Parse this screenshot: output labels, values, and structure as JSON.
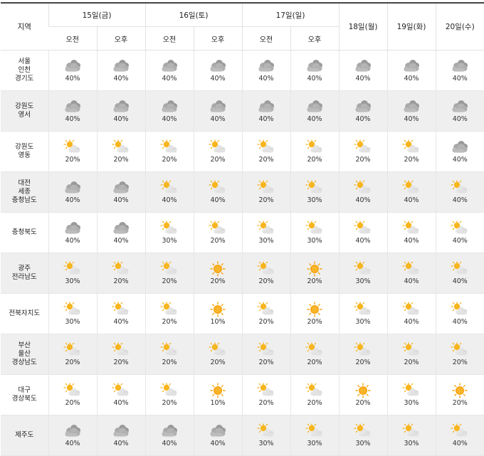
{
  "header": {
    "region": "지역",
    "days": [
      {
        "label": "15일(금)",
        "am": "오전",
        "pm": "오후"
      },
      {
        "label": "16일(토)",
        "am": "오전",
        "pm": "오후"
      },
      {
        "label": "17일(일)",
        "am": "오전",
        "pm": "오후"
      },
      {
        "label": "18일(월)"
      },
      {
        "label": "19일(화)"
      },
      {
        "label": "20일(수)"
      }
    ]
  },
  "icons": {
    "cloud": "cloudy-icon",
    "partly": "partly-cloudy-icon",
    "sun": "sunny-icon"
  },
  "rows": [
    {
      "region": "서울\n인천\n경기도",
      "cells": [
        [
          "cloud",
          "40%"
        ],
        [
          "cloud",
          "40%"
        ],
        [
          "cloud",
          "40%"
        ],
        [
          "cloud",
          "40%"
        ],
        [
          "cloud",
          "40%"
        ],
        [
          "cloud",
          "40%"
        ],
        [
          "cloud",
          "40%"
        ],
        [
          "cloud",
          "40%"
        ],
        [
          "cloud",
          "40%"
        ]
      ]
    },
    {
      "region": "강원도\n영서",
      "cells": [
        [
          "cloud",
          "40%"
        ],
        [
          "cloud",
          "40%"
        ],
        [
          "cloud",
          "40%"
        ],
        [
          "cloud",
          "40%"
        ],
        [
          "cloud",
          "40%"
        ],
        [
          "cloud",
          "40%"
        ],
        [
          "cloud",
          "40%"
        ],
        [
          "cloud",
          "40%"
        ],
        [
          "cloud",
          "40%"
        ]
      ]
    },
    {
      "region": "강원도\n영동",
      "cells": [
        [
          "partly",
          "20%"
        ],
        [
          "partly",
          "20%"
        ],
        [
          "partly",
          "20%"
        ],
        [
          "partly",
          "20%"
        ],
        [
          "partly",
          "20%"
        ],
        [
          "partly",
          "20%"
        ],
        [
          "partly",
          "20%"
        ],
        [
          "partly",
          "20%"
        ],
        [
          "cloud",
          "40%"
        ]
      ]
    },
    {
      "region": "대전\n세종\n충청남도",
      "cells": [
        [
          "cloud",
          "40%"
        ],
        [
          "cloud",
          "40%"
        ],
        [
          "partly",
          "40%"
        ],
        [
          "partly",
          "40%"
        ],
        [
          "partly",
          "20%"
        ],
        [
          "partly",
          "30%"
        ],
        [
          "partly",
          "40%"
        ],
        [
          "partly",
          "40%"
        ],
        [
          "partly",
          "40%"
        ]
      ]
    },
    {
      "region": "충청북도",
      "cells": [
        [
          "cloud",
          "40%"
        ],
        [
          "cloud",
          "40%"
        ],
        [
          "partly",
          "30%"
        ],
        [
          "partly",
          "20%"
        ],
        [
          "partly",
          "30%"
        ],
        [
          "partly",
          "30%"
        ],
        [
          "partly",
          "40%"
        ],
        [
          "partly",
          "40%"
        ],
        [
          "partly",
          "40%"
        ]
      ]
    },
    {
      "region": "광주\n전라남도",
      "cells": [
        [
          "partly",
          "30%"
        ],
        [
          "partly",
          "20%"
        ],
        [
          "partly",
          "20%"
        ],
        [
          "sun",
          "20%"
        ],
        [
          "partly",
          "20%"
        ],
        [
          "sun",
          "20%"
        ],
        [
          "partly",
          "30%"
        ],
        [
          "partly",
          "40%"
        ],
        [
          "partly",
          "40%"
        ]
      ]
    },
    {
      "region": "전북자치도",
      "cells": [
        [
          "partly",
          "30%"
        ],
        [
          "partly",
          "40%"
        ],
        [
          "partly",
          "20%"
        ],
        [
          "sun",
          "10%"
        ],
        [
          "partly",
          "20%"
        ],
        [
          "sun",
          "20%"
        ],
        [
          "partly",
          "30%"
        ],
        [
          "partly",
          "40%"
        ],
        [
          "partly",
          "40%"
        ]
      ]
    },
    {
      "region": "부산\n울산\n경상남도",
      "cells": [
        [
          "partly",
          "20%"
        ],
        [
          "partly",
          "20%"
        ],
        [
          "partly",
          "20%"
        ],
        [
          "partly",
          "20%"
        ],
        [
          "partly",
          "20%"
        ],
        [
          "partly",
          "20%"
        ],
        [
          "partly",
          "20%"
        ],
        [
          "partly",
          "20%"
        ],
        [
          "partly",
          "20%"
        ]
      ]
    },
    {
      "region": "대구\n경상북도",
      "cells": [
        [
          "partly",
          "20%"
        ],
        [
          "partly",
          "40%"
        ],
        [
          "partly",
          "20%"
        ],
        [
          "sun",
          "10%"
        ],
        [
          "partly",
          "20%"
        ],
        [
          "partly",
          "20%"
        ],
        [
          "sun",
          "20%"
        ],
        [
          "partly",
          "30%"
        ],
        [
          "sun",
          "20%"
        ]
      ]
    },
    {
      "region": "제주도",
      "cells": [
        [
          "cloud",
          "40%"
        ],
        [
          "cloud",
          "40%"
        ],
        [
          "cloud",
          "40%"
        ],
        [
          "cloud",
          "40%"
        ],
        [
          "partly",
          "30%"
        ],
        [
          "partly",
          "30%"
        ],
        [
          "partly",
          "30%"
        ],
        [
          "partly",
          "30%"
        ],
        [
          "partly",
          "40%"
        ]
      ]
    }
  ]
}
